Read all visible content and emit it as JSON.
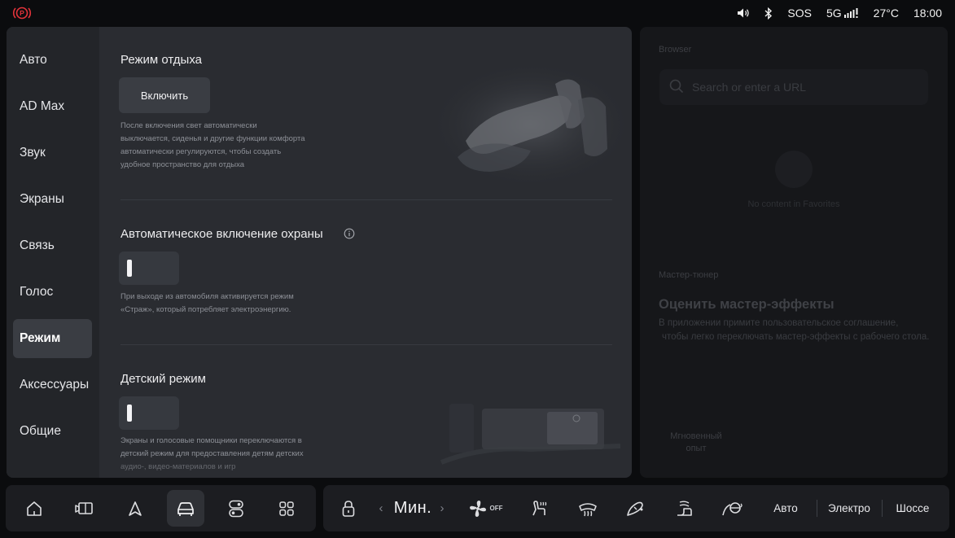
{
  "status": {
    "sos": "SOS",
    "network": "5G",
    "temperature": "27°C",
    "time": "18:00",
    "icons": [
      "parking-brake-icon",
      "volume-icon",
      "bluetooth-icon",
      "signal-icon"
    ]
  },
  "sidebar": {
    "items": [
      {
        "label": "Авто"
      },
      {
        "label": "AD Max"
      },
      {
        "label": "Звук"
      },
      {
        "label": "Экраны"
      },
      {
        "label": "Связь"
      },
      {
        "label": "Голос"
      },
      {
        "label": "Режим",
        "active": true
      },
      {
        "label": "Аксессуары"
      },
      {
        "label": "Общие"
      }
    ]
  },
  "rest_mode": {
    "title": "Режим отдыха",
    "button": "Включить",
    "desc_lines": [
      "После включения свет автоматически",
      "выключается, сиденья и другие функции комфорта",
      "автоматически регулируются, чтобы создать",
      "удобное пространство для отдыха"
    ]
  },
  "auto_guard": {
    "title": "Автоматическое включение охраны",
    "enabled": false,
    "desc_lines": [
      "При выходе из автомобиля активируется режим",
      "«Страж», который потребляет электроэнергию."
    ]
  },
  "kids_mode": {
    "title": "Детский режим",
    "enabled": false,
    "desc_lines": [
      "Экраны и голосовые помощники переключаются в",
      "детский режим для предоставления детям детских",
      "аудио-, видео-материалов и игр"
    ]
  },
  "right_panel": {
    "browser_label": "Browser",
    "search_placeholder": "Search or enter a URL",
    "empty_text": "No content in Favorites",
    "tuner_label": "Мастер-тюнер",
    "tuner_title": "Оценить мастер-эффекты",
    "tuner_desc_lines": [
      "В приложении примите пользовательское соглашение,",
      "чтобы легко переключать мастер-эффекты с рабочего стола."
    ],
    "instant_lines": [
      "Мгновенный",
      "опыт"
    ]
  },
  "dock": {
    "left_icons": [
      "home-icon",
      "screen-icon",
      "navigation-icon",
      "car-icon",
      "toggle-apps-icon",
      "apps-grid-icon"
    ],
    "active_left": "car-icon",
    "climate_temp": "Мин.",
    "fan_state": "OFF",
    "modes": [
      "Авто",
      "Электро",
      "Шоссе"
    ]
  },
  "colors": {
    "panel": "#2a2c31",
    "sidebar": "#232529",
    "active": "#3a3d43",
    "park_red": "#e2333a"
  }
}
